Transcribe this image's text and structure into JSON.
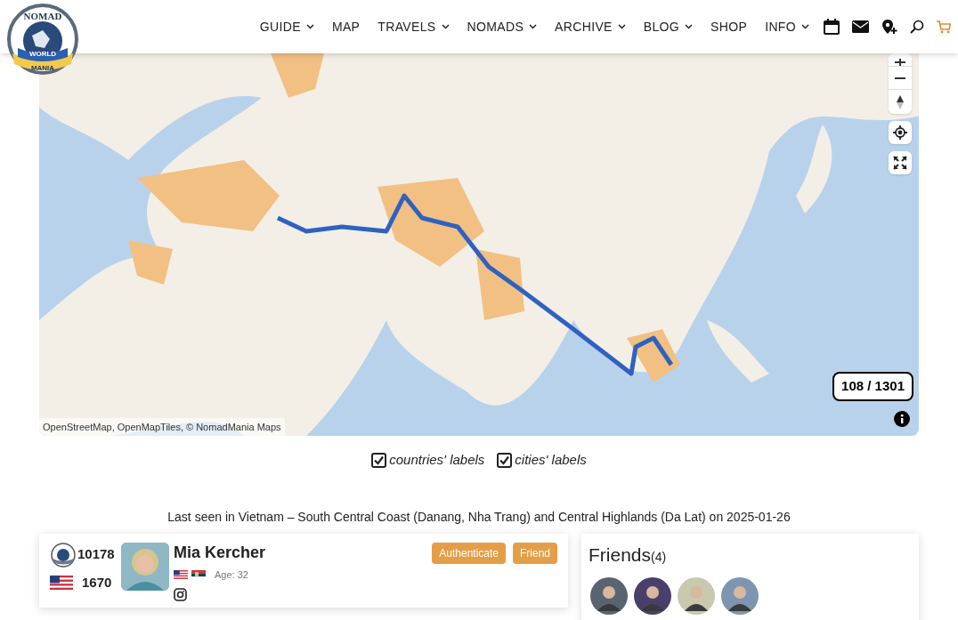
{
  "logo": {
    "lines": [
      "NOMAD",
      "WORLD",
      "MANIA"
    ]
  },
  "nav": [
    {
      "label": "GUIDE",
      "dropdown": true
    },
    {
      "label": "MAP",
      "dropdown": false
    },
    {
      "label": "TRAVELS",
      "dropdown": true
    },
    {
      "label": "NOMADS",
      "dropdown": true
    },
    {
      "label": "ARCHIVE",
      "dropdown": true
    },
    {
      "label": "BLOG",
      "dropdown": true
    },
    {
      "label": "SHOP",
      "dropdown": false
    },
    {
      "label": "INFO",
      "dropdown": true
    }
  ],
  "map": {
    "counter": "108 / 1301",
    "attribution": "OpenStreetMap, OpenMapTiles, © NomadMania Maps"
  },
  "toggles": [
    {
      "label": "countries' labels",
      "checked": true
    },
    {
      "label": "cities' labels",
      "checked": true
    }
  ],
  "last_seen": "Last seen in Vietnam – South Central Coast (Danang, Nha Trang) and Central Highlands (Da Lat) on 2025-01-26",
  "profile": {
    "score_nm": "10178",
    "score_un": "1670",
    "name": "Mia Kercher",
    "age": "Age: 32",
    "buttons": [
      "Authenticate",
      "Friend"
    ]
  },
  "friends": {
    "title": "Friends",
    "count": "(4)"
  }
}
